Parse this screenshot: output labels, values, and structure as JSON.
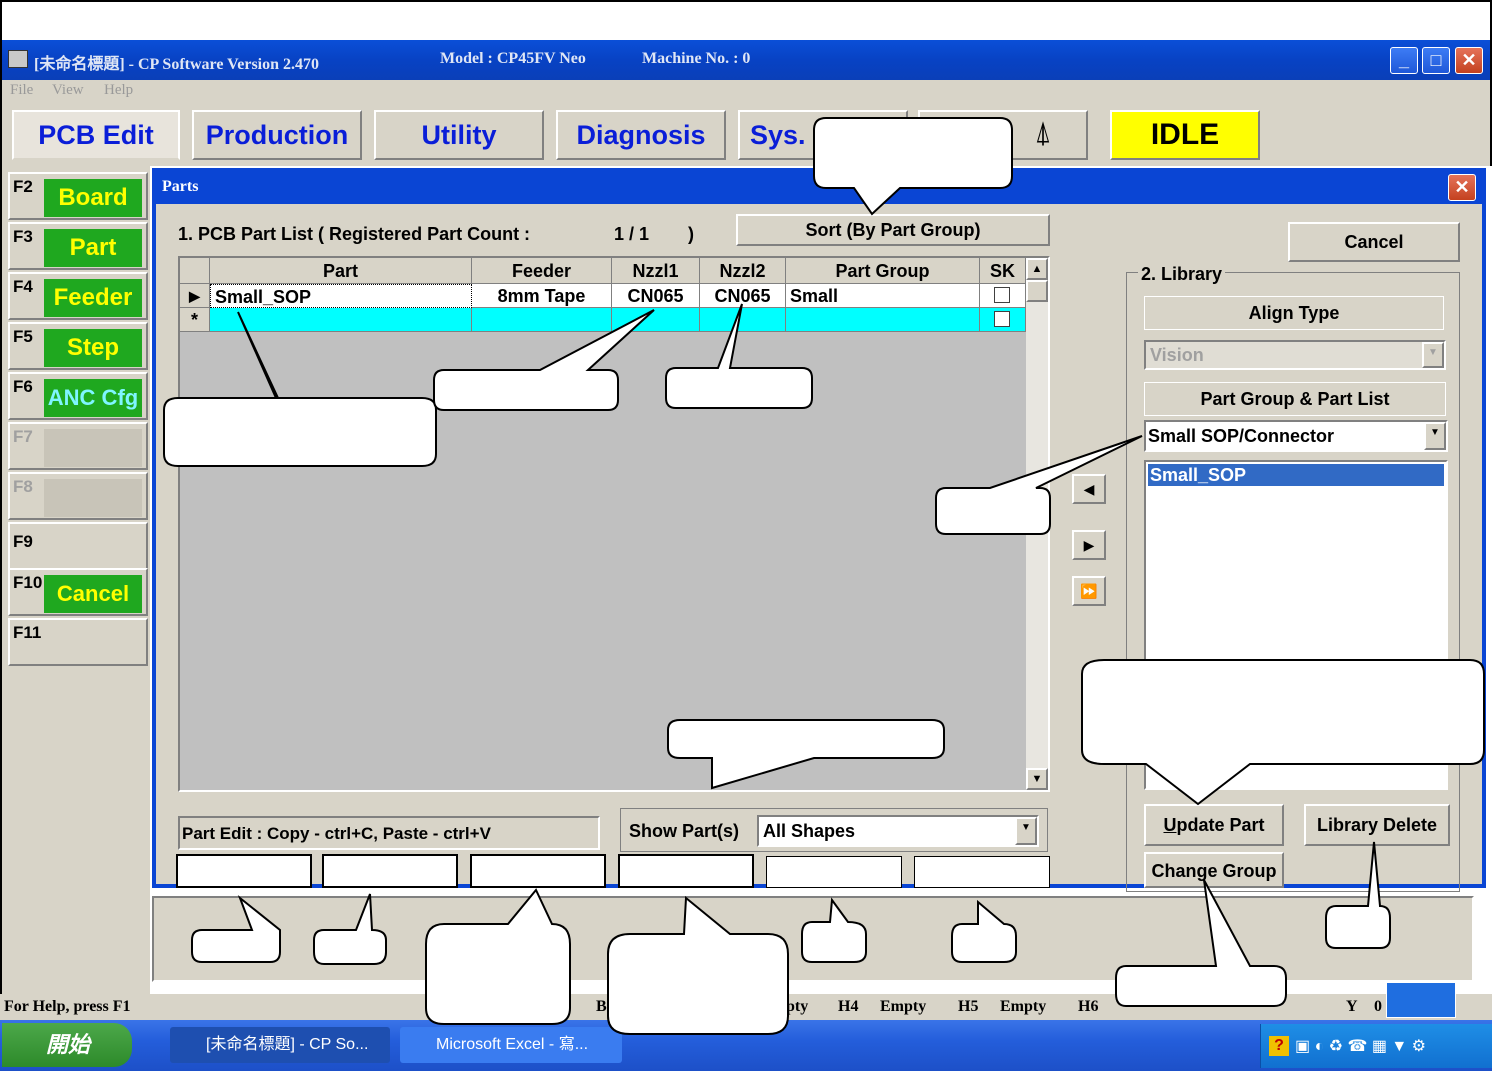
{
  "titlebar": {
    "app": "[未命名標題] - CP Software Version 2.470",
    "model": "Model : CP45FV Neo",
    "machine": "Machine No. : 0"
  },
  "menu": [
    "File",
    "View",
    "Help"
  ],
  "toolbar": {
    "tabs": [
      "PCB Edit",
      "Production",
      "Utility",
      "Diagnosis",
      "Sys."
    ],
    "status": "IDLE"
  },
  "fkeys": [
    {
      "key": "F2",
      "label": "Board"
    },
    {
      "key": "F3",
      "label": "Part"
    },
    {
      "key": "F4",
      "label": "Feeder"
    },
    {
      "key": "F5",
      "label": "Step"
    },
    {
      "key": "F6",
      "label": "ANC Cfg"
    },
    {
      "key": "F7",
      "label": ""
    },
    {
      "key": "F8",
      "label": ""
    },
    {
      "key": "F9",
      "label": ""
    },
    {
      "key": "F10",
      "label": "Cancel"
    },
    {
      "key": "F11",
      "label": ""
    }
  ],
  "dialog": {
    "title": "Parts",
    "part_list_title": "1. PCB Part List  ( Registered Part Count :",
    "part_count": "1 / 1",
    "part_count_close": ")",
    "sort_button": "Sort (By Part Group)",
    "cancel_button": "Cancel",
    "grid": {
      "columns": [
        "Part",
        "Feeder",
        "Nzzl1",
        "Nzzl2",
        "Part Group",
        "SK"
      ],
      "rows": [
        {
          "marker": "▶",
          "part": "Small_SOP",
          "feeder": "8mm Tape",
          "nzzl1": "CN065",
          "nzzl2": "CN065",
          "group": "Small"
        }
      ],
      "new_row_marker": "*"
    },
    "part_edit_hint": "Part Edit : Copy - ctrl+C,  Paste - ctrl+V",
    "show_parts_label": "Show Part(s)",
    "show_parts_value": "All Shapes",
    "library": {
      "title": "2. Library",
      "align_type_label": "Align Type",
      "align_type_value": "Vision",
      "group_list_label": "Part Group & Part List",
      "group_value": "Small SOP/Connector",
      "list_items": [
        "Small_SOP"
      ],
      "update_button": "Update Part",
      "delete_button": "Library Delete",
      "change_group_button": "Change Group"
    }
  },
  "statusbar": {
    "help": "For Help, press F1",
    "items": [
      "H4",
      "Empty",
      "H5",
      "Empty",
      "H6",
      "Y",
      "0"
    ],
    "frag_b": "B",
    "frag_pty": "pty"
  },
  "taskbar": {
    "start": "開始",
    "tasks": [
      "[未命名標題] - CP So...",
      "Microsoft Excel - 寫..."
    ]
  }
}
